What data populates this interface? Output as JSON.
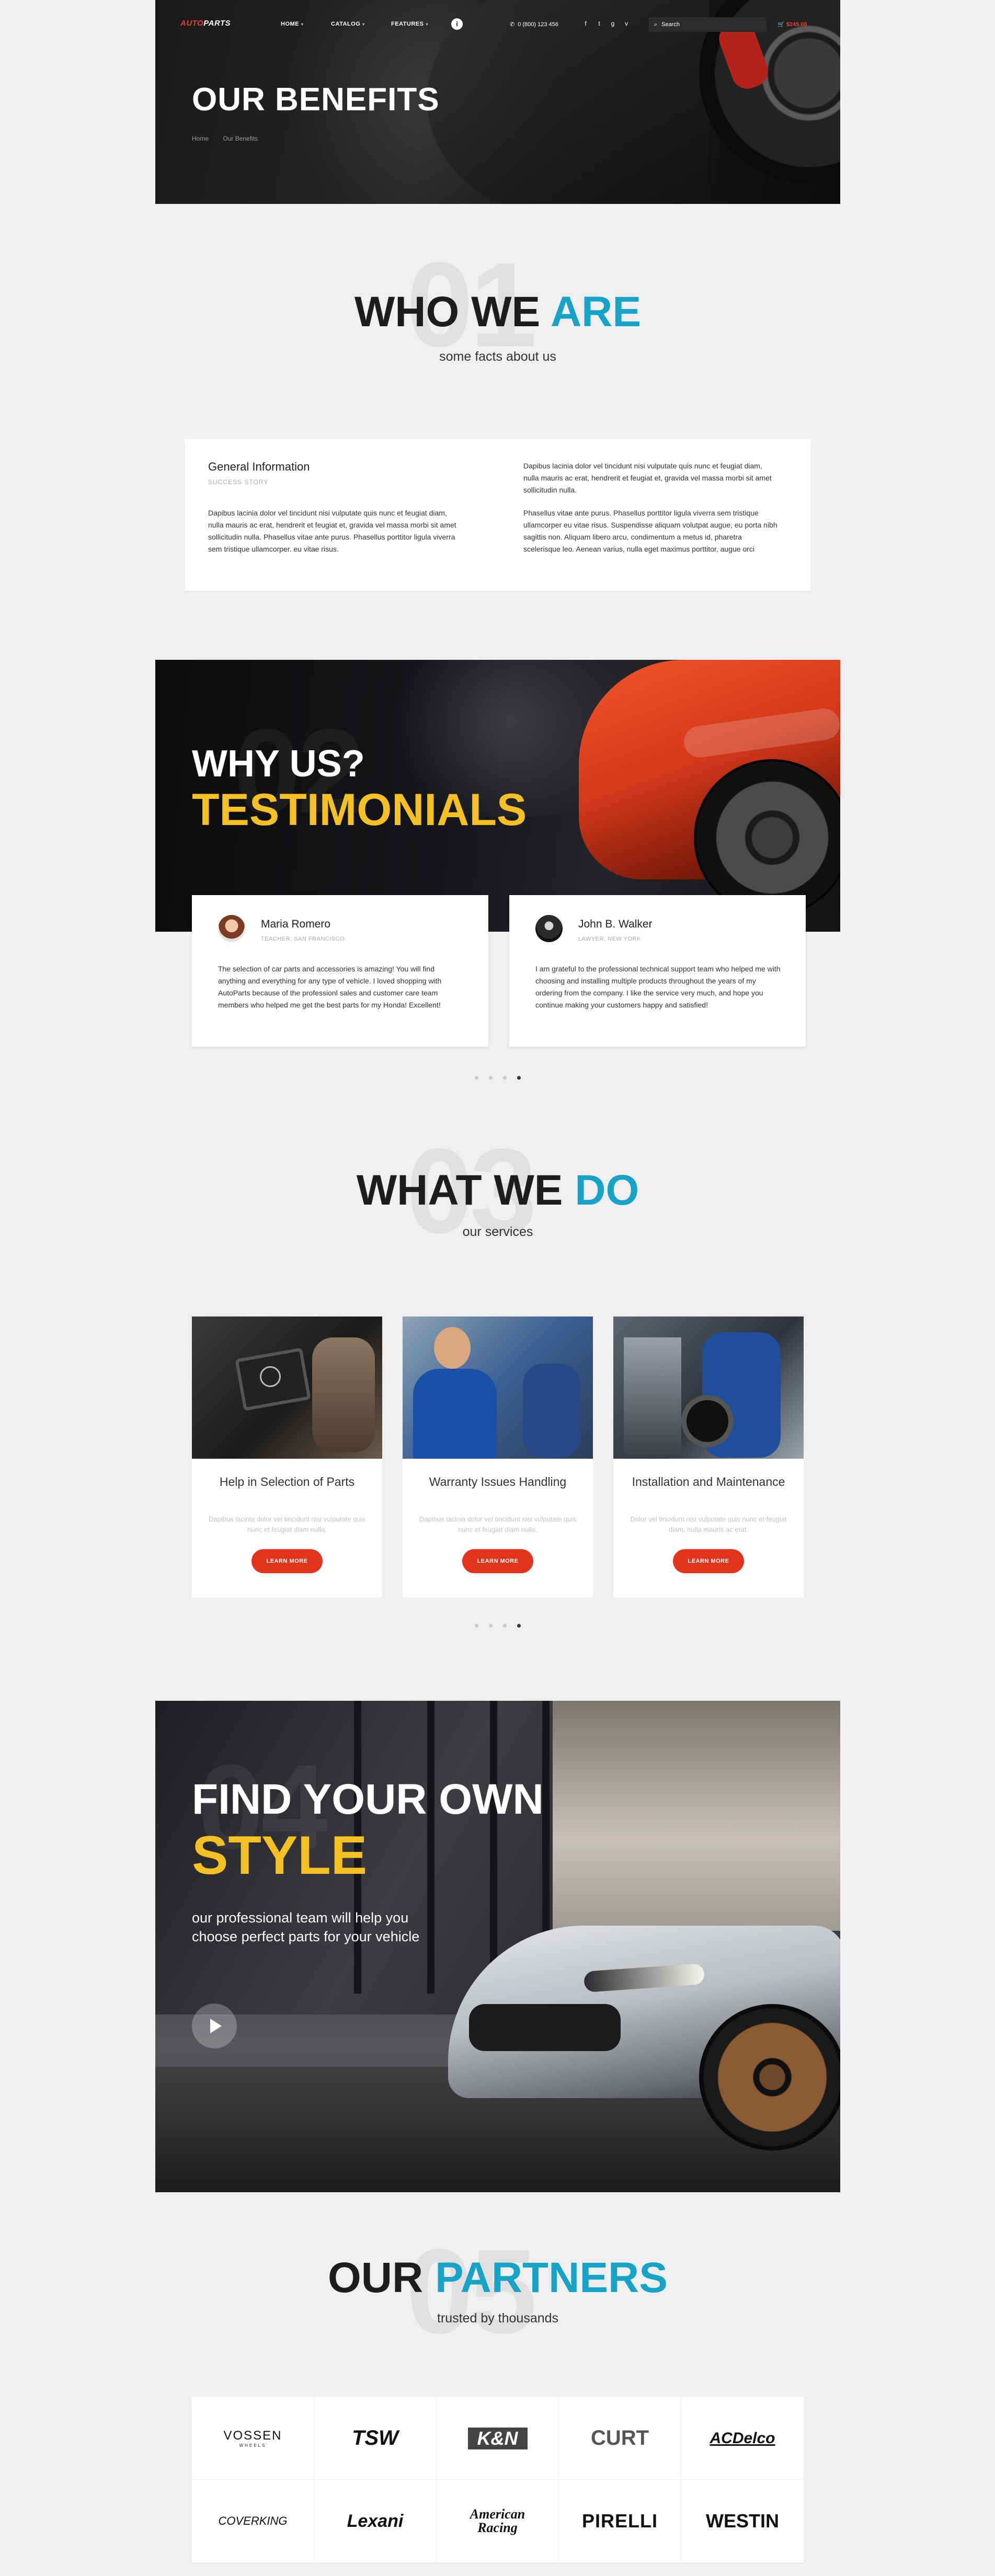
{
  "header": {
    "logo_prefix": "AUTO",
    "logo_suffix": "PARTS",
    "nav": [
      {
        "label": "HOME"
      },
      {
        "label": "CATALOG"
      },
      {
        "label": "FEATURES"
      }
    ],
    "info_label": "i",
    "phone": "0 (800) 123 456",
    "social_icons": [
      "f",
      "t",
      "g",
      "v"
    ],
    "search_placeholder": "Search",
    "cart_total": "$245.00"
  },
  "hero": {
    "title": "OUR BENEFITS",
    "breadcrumbs": [
      "Home",
      "Our Benefits"
    ]
  },
  "who": {
    "number": "01",
    "title_dark": "WHO WE",
    "title_blue": "ARE",
    "subtitle": "some facts about us",
    "card_title": "General Information",
    "card_subtitle": "SUCCESS STORY",
    "left_text": "Dapibus lacinia dolor vel tincidunt nisi vulputate quis nunc et feugiat diam, nulla mauris ac erat, hendrerit et feugiat et, gravida vel massa morbi sit amet sollicitudin nulla. Phasellus vitae ante purus. Phasellus porttitor ligula viverra sem tristique ullamcorper. eu vitae risus.",
    "right_text_1": "Dapibus lacinia dolor vel tincidunt nisi vulputate quis nunc et feugiat diam, nulla mauris ac erat, hendrerit et feugiat et, gravida vel massa morbi sit amet sollicitudin nulla.",
    "right_text_2": "Phasellus vitae ante purus. Phasellus porttitor ligula viverra sem tristique ullamcorper eu vitae risus. Suspendisse aliquam volutpat augue, eu porta nibh sagittis non. Aliquam libero arcu, condimentum a metus id, pharetra scelerisque leo. Aenean varius, nulla eget maximus porttitor, augue orci"
  },
  "testimonials": {
    "number": "02",
    "title_white": "WHY US?",
    "title_yellow": "TESTIMONIALS",
    "items": [
      {
        "name": "Maria Romero",
        "role": "TEACHER, SAN FRANCISCO",
        "text": "The selection of car parts and accessories is amazing! You will find anything and everything for any type of vehicle. I loved shopping with AutoParts because of the professionl sales and customer care team members who helped me get the best parts for my Honda! Excellent!"
      },
      {
        "name": "John B. Walker",
        "role": "LAWYER, NEW YORK",
        "text": "I am grateful to the professional technical support team who helped me with choosing and installing multiple products throughout the years of my ordering from the company. I like the service very much, and hope you continue making your customers happy and satisfied!"
      }
    ]
  },
  "services": {
    "number": "03",
    "title_dark": "WHAT WE",
    "title_blue": "DO",
    "subtitle": "our services",
    "items": [
      {
        "title": "Help in Selection of Parts",
        "text": "Dapibus lacinia dolor vel tincidunt nisi vulputate quis nunc et feugiat diam nulla.",
        "button": "LEARN MORE"
      },
      {
        "title": "Warranty Issues Handling",
        "text": "Dapibus lacinia dolor vel tincidunt nisi vulputate quis nunc et feugiat diam nulla.",
        "button": "LEARN MORE"
      },
      {
        "title": "Installation and Maintenance",
        "text": "Dolor vel tincidunt nisi vulputate quis nunc et feugiat diam, nulla mauris ac erat.",
        "button": "LEARN MORE"
      }
    ]
  },
  "style": {
    "number": "04",
    "title_white": "FIND YOUR OWN",
    "title_yellow": "STYLE",
    "text": "our professional team will help you choose perfect parts for your vehicle"
  },
  "partners": {
    "number": "05",
    "title_dark": "OUR",
    "title_blue": "PARTNERS",
    "subtitle": "trusted by thousands",
    "logos": [
      "VOSSEN",
      "TSW",
      "K&N",
      "CURT",
      "ACDelco",
      "COVERKING",
      "Lexani",
      "American Racing",
      "PIRELLI",
      "WESTIN"
    ],
    "vossen_sub": "WHEELS"
  },
  "colors": {
    "accent_blue": "#17a2c7",
    "accent_yellow": "#f5c024",
    "accent_red": "#e2331d"
  }
}
